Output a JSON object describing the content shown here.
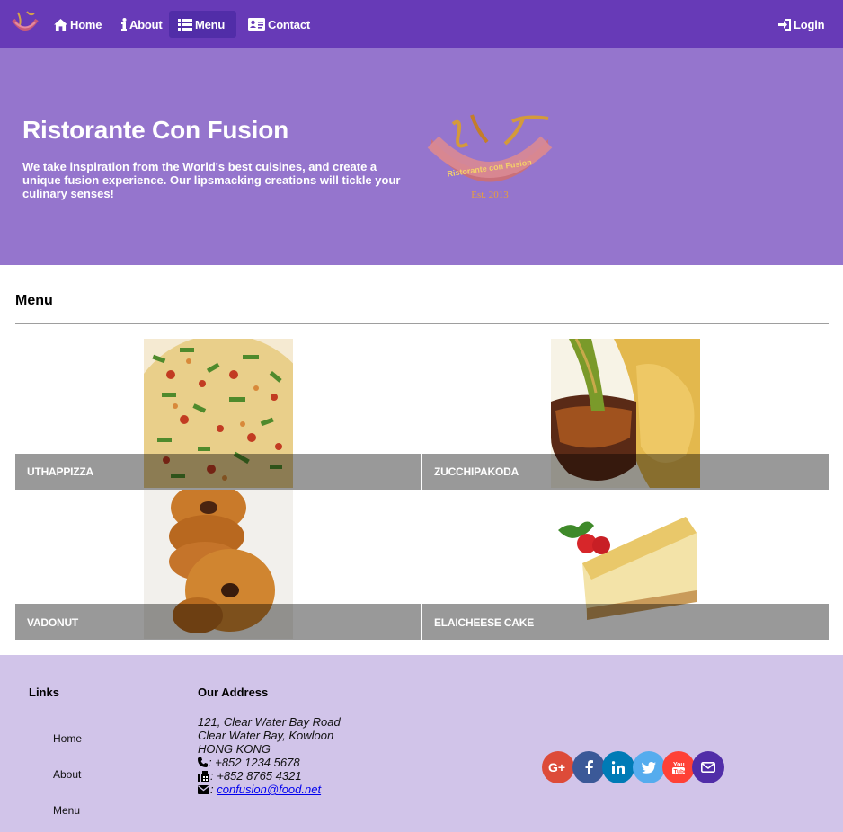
{
  "navbar": {
    "brand_icon": "restaurant-logo-icon",
    "items": [
      {
        "label": "Home",
        "icon": "home-icon"
      },
      {
        "label": "About",
        "icon": "info-icon"
      },
      {
        "label": "Menu",
        "icon": "list-icon",
        "active": true
      },
      {
        "label": "Contact",
        "icon": "address-card-icon"
      }
    ],
    "login_label": "Login",
    "colors": {
      "bar": "#673ab7",
      "active": "#512da8"
    }
  },
  "jumbotron": {
    "title": "Ristorante Con Fusion",
    "text": "We take inspiration from the World's best cuisines, and create a unique fusion experience. Our lipsmacking creations will tickle your culinary senses!",
    "logo_text": "Ristorante con Fusion",
    "logo_est": "Est. 2013",
    "color": "#9575cd"
  },
  "menu": {
    "title": "Menu",
    "items": [
      {
        "name": "UTHAPPIZZA",
        "image": "pizza-image"
      },
      {
        "name": "ZUCCHIPAKODA",
        "image": "pakoda-image"
      },
      {
        "name": "VADONUT",
        "image": "vadonut-image"
      },
      {
        "name": "ELAICHEESE CAKE",
        "image": "cheesecake-image"
      }
    ]
  },
  "footer": {
    "links_title": "Links",
    "links": [
      "Home",
      "About",
      "Menu"
    ],
    "address_title": "Our Address",
    "address_lines": [
      "121, Clear Water Bay Road",
      "Clear Water Bay, Kowloon",
      "HONG KONG"
    ],
    "phone": ": +852 1234 5678",
    "fax": ": +852 8765 4321",
    "email_prefix": ": ",
    "email": "confusion@food.net",
    "social": [
      {
        "name": "google-plus-icon",
        "color": "#dd4b39"
      },
      {
        "name": "facebook-icon",
        "color": "#3b5998"
      },
      {
        "name": "linkedin-icon",
        "color": "#007bb6"
      },
      {
        "name": "twitter-icon",
        "color": "#55acee"
      },
      {
        "name": "youtube-icon",
        "color": "#ff4136"
      },
      {
        "name": "mail-icon",
        "color": "#512da8"
      }
    ],
    "color": "#d1c4e9"
  }
}
